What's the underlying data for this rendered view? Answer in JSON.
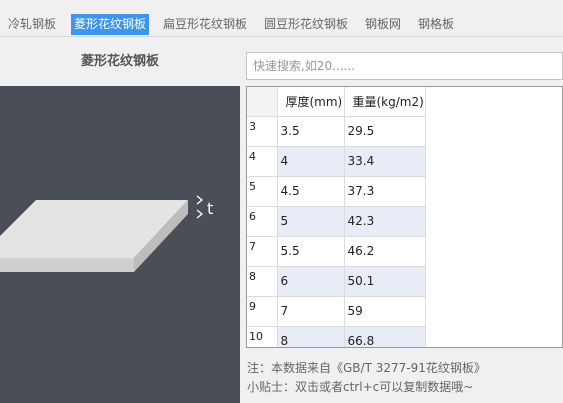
{
  "tabs": [
    {
      "label": "冷轧钢板",
      "active": false
    },
    {
      "label": "菱形花纹钢板",
      "active": true
    },
    {
      "label": "扁豆形花纹钢板",
      "active": false
    },
    {
      "label": "圆豆形花纹钢板",
      "active": false
    },
    {
      "label": "钢板网",
      "active": false
    },
    {
      "label": "钢格板",
      "active": false
    }
  ],
  "left": {
    "title": "菱形花纹钢板",
    "dimension_label": "t"
  },
  "search": {
    "placeholder": "快速搜索,如20......",
    "value": ""
  },
  "table": {
    "headers": [
      "厚度(mm)",
      "重量(kg/m2)"
    ],
    "rows": [
      {
        "index": "3",
        "thickness": "3.5",
        "weight": "29.5"
      },
      {
        "index": "4",
        "thickness": "4",
        "weight": "33.4"
      },
      {
        "index": "5",
        "thickness": "4.5",
        "weight": "37.3"
      },
      {
        "index": "6",
        "thickness": "5",
        "weight": "42.3"
      },
      {
        "index": "7",
        "thickness": "5.5",
        "weight": "46.2"
      },
      {
        "index": "8",
        "thickness": "6",
        "weight": "50.1"
      },
      {
        "index": "9",
        "thickness": "7",
        "weight": "59"
      },
      {
        "index": "10",
        "thickness": "8",
        "weight": "66.8"
      }
    ]
  },
  "notes": {
    "source": "注：本数据来自《GB/T 3277-91花纹钢板》",
    "tip": "小贴士：双击或者ctrl+c可以复制数据哦~"
  },
  "colors": {
    "tab_active": "#3c95f0",
    "drawing_bg": "#4a4f57",
    "row_alt": "#e7ecf7"
  }
}
